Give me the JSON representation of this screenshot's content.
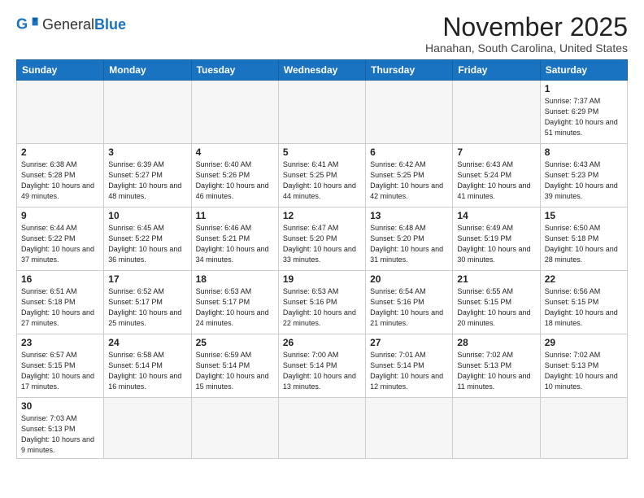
{
  "logo": {
    "general": "General",
    "blue": "Blue"
  },
  "title": "November 2025",
  "location": "Hanahan, South Carolina, United States",
  "weekdays": [
    "Sunday",
    "Monday",
    "Tuesday",
    "Wednesday",
    "Thursday",
    "Friday",
    "Saturday"
  ],
  "weeks": [
    [
      {
        "day": "",
        "info": ""
      },
      {
        "day": "",
        "info": ""
      },
      {
        "day": "",
        "info": ""
      },
      {
        "day": "",
        "info": ""
      },
      {
        "day": "",
        "info": ""
      },
      {
        "day": "",
        "info": ""
      },
      {
        "day": "1",
        "info": "Sunrise: 7:37 AM\nSunset: 6:29 PM\nDaylight: 10 hours and 51 minutes."
      }
    ],
    [
      {
        "day": "2",
        "info": "Sunrise: 6:38 AM\nSunset: 5:28 PM\nDaylight: 10 hours and 49 minutes."
      },
      {
        "day": "3",
        "info": "Sunrise: 6:39 AM\nSunset: 5:27 PM\nDaylight: 10 hours and 48 minutes."
      },
      {
        "day": "4",
        "info": "Sunrise: 6:40 AM\nSunset: 5:26 PM\nDaylight: 10 hours and 46 minutes."
      },
      {
        "day": "5",
        "info": "Sunrise: 6:41 AM\nSunset: 5:25 PM\nDaylight: 10 hours and 44 minutes."
      },
      {
        "day": "6",
        "info": "Sunrise: 6:42 AM\nSunset: 5:25 PM\nDaylight: 10 hours and 42 minutes."
      },
      {
        "day": "7",
        "info": "Sunrise: 6:43 AM\nSunset: 5:24 PM\nDaylight: 10 hours and 41 minutes."
      },
      {
        "day": "8",
        "info": "Sunrise: 6:43 AM\nSunset: 5:23 PM\nDaylight: 10 hours and 39 minutes."
      }
    ],
    [
      {
        "day": "9",
        "info": "Sunrise: 6:44 AM\nSunset: 5:22 PM\nDaylight: 10 hours and 37 minutes."
      },
      {
        "day": "10",
        "info": "Sunrise: 6:45 AM\nSunset: 5:22 PM\nDaylight: 10 hours and 36 minutes."
      },
      {
        "day": "11",
        "info": "Sunrise: 6:46 AM\nSunset: 5:21 PM\nDaylight: 10 hours and 34 minutes."
      },
      {
        "day": "12",
        "info": "Sunrise: 6:47 AM\nSunset: 5:20 PM\nDaylight: 10 hours and 33 minutes."
      },
      {
        "day": "13",
        "info": "Sunrise: 6:48 AM\nSunset: 5:20 PM\nDaylight: 10 hours and 31 minutes."
      },
      {
        "day": "14",
        "info": "Sunrise: 6:49 AM\nSunset: 5:19 PM\nDaylight: 10 hours and 30 minutes."
      },
      {
        "day": "15",
        "info": "Sunrise: 6:50 AM\nSunset: 5:18 PM\nDaylight: 10 hours and 28 minutes."
      }
    ],
    [
      {
        "day": "16",
        "info": "Sunrise: 6:51 AM\nSunset: 5:18 PM\nDaylight: 10 hours and 27 minutes."
      },
      {
        "day": "17",
        "info": "Sunrise: 6:52 AM\nSunset: 5:17 PM\nDaylight: 10 hours and 25 minutes."
      },
      {
        "day": "18",
        "info": "Sunrise: 6:53 AM\nSunset: 5:17 PM\nDaylight: 10 hours and 24 minutes."
      },
      {
        "day": "19",
        "info": "Sunrise: 6:53 AM\nSunset: 5:16 PM\nDaylight: 10 hours and 22 minutes."
      },
      {
        "day": "20",
        "info": "Sunrise: 6:54 AM\nSunset: 5:16 PM\nDaylight: 10 hours and 21 minutes."
      },
      {
        "day": "21",
        "info": "Sunrise: 6:55 AM\nSunset: 5:15 PM\nDaylight: 10 hours and 20 minutes."
      },
      {
        "day": "22",
        "info": "Sunrise: 6:56 AM\nSunset: 5:15 PM\nDaylight: 10 hours and 18 minutes."
      }
    ],
    [
      {
        "day": "23",
        "info": "Sunrise: 6:57 AM\nSunset: 5:15 PM\nDaylight: 10 hours and 17 minutes."
      },
      {
        "day": "24",
        "info": "Sunrise: 6:58 AM\nSunset: 5:14 PM\nDaylight: 10 hours and 16 minutes."
      },
      {
        "day": "25",
        "info": "Sunrise: 6:59 AM\nSunset: 5:14 PM\nDaylight: 10 hours and 15 minutes."
      },
      {
        "day": "26",
        "info": "Sunrise: 7:00 AM\nSunset: 5:14 PM\nDaylight: 10 hours and 13 minutes."
      },
      {
        "day": "27",
        "info": "Sunrise: 7:01 AM\nSunset: 5:14 PM\nDaylight: 10 hours and 12 minutes."
      },
      {
        "day": "28",
        "info": "Sunrise: 7:02 AM\nSunset: 5:13 PM\nDaylight: 10 hours and 11 minutes."
      },
      {
        "day": "29",
        "info": "Sunrise: 7:02 AM\nSunset: 5:13 PM\nDaylight: 10 hours and 10 minutes."
      }
    ],
    [
      {
        "day": "30",
        "info": "Sunrise: 7:03 AM\nSunset: 5:13 PM\nDaylight: 10 hours and 9 minutes."
      },
      {
        "day": "",
        "info": ""
      },
      {
        "day": "",
        "info": ""
      },
      {
        "day": "",
        "info": ""
      },
      {
        "day": "",
        "info": ""
      },
      {
        "day": "",
        "info": ""
      },
      {
        "day": "",
        "info": ""
      }
    ]
  ]
}
